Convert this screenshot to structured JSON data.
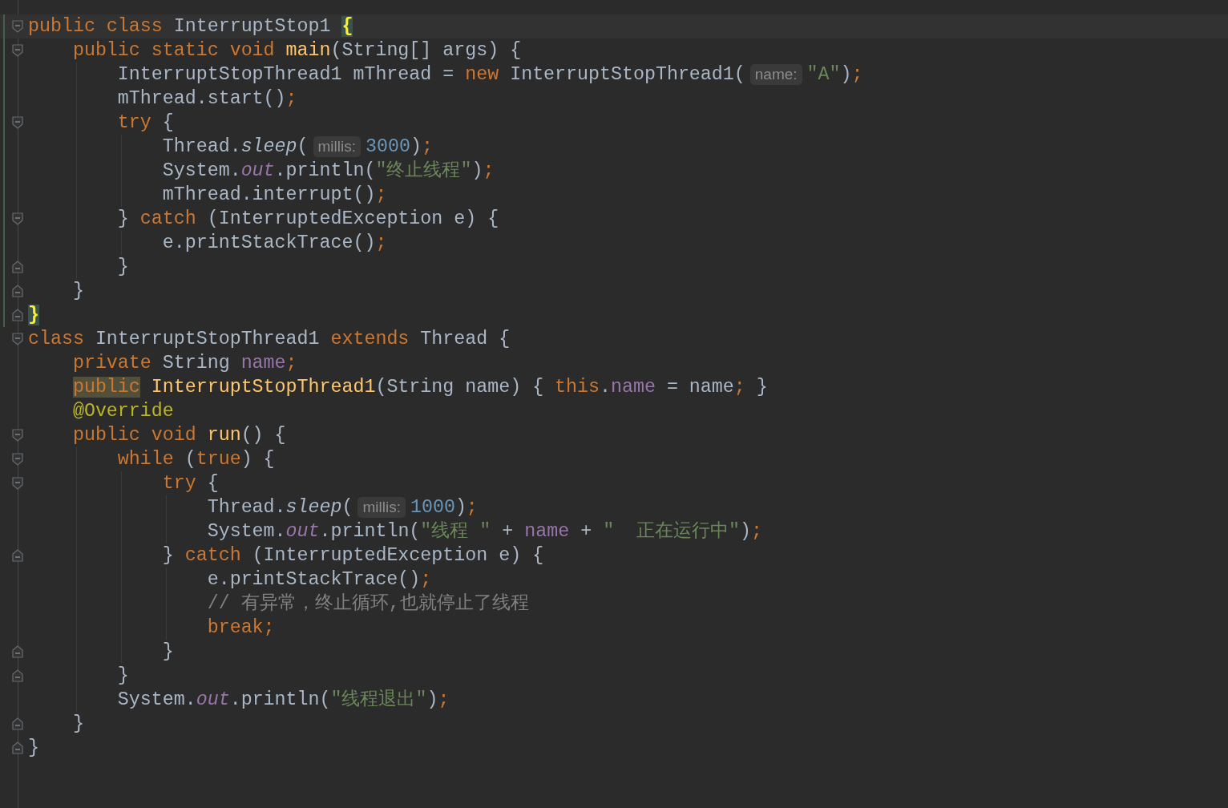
{
  "editor": {
    "lines": [
      {
        "kind": "fold-start",
        "current": true,
        "changed": true,
        "segments": [
          {
            "kind": "keyword",
            "text": "public class "
          },
          {
            "kind": "plain",
            "text": "InterruptStop1 "
          },
          {
            "kind": "brace-match",
            "text": "{"
          }
        ]
      },
      {
        "kind": "fold-start",
        "current": false,
        "changed": true,
        "segments": [
          {
            "kind": "keyword",
            "text": "    public static void "
          },
          {
            "kind": "declaration",
            "text": "main"
          },
          {
            "kind": "plain",
            "text": "(String[] args) {"
          }
        ]
      },
      {
        "kind": "line",
        "current": false,
        "changed": true,
        "segments": [
          {
            "kind": "plain",
            "text": "        InterruptStopThread1 mThread = "
          },
          {
            "kind": "keyword",
            "text": "new "
          },
          {
            "kind": "plain",
            "text": "InterruptStopThread1("
          },
          {
            "kind": "hint",
            "text": "name:"
          },
          {
            "kind": "string",
            "text": "\"A\""
          },
          {
            "kind": "plain",
            "text": ")"
          },
          {
            "kind": "keyword",
            "text": ";"
          }
        ]
      },
      {
        "kind": "line",
        "current": false,
        "changed": true,
        "segments": [
          {
            "kind": "plain",
            "text": "        mThread.start()"
          },
          {
            "kind": "keyword",
            "text": ";"
          }
        ]
      },
      {
        "kind": "fold-start",
        "current": false,
        "changed": true,
        "segments": [
          {
            "kind": "keyword",
            "text": "        try "
          },
          {
            "kind": "plain",
            "text": "{"
          }
        ]
      },
      {
        "kind": "line",
        "current": false,
        "changed": true,
        "segments": [
          {
            "kind": "plain",
            "text": "            Thread."
          },
          {
            "kind": "italic",
            "text": "sleep"
          },
          {
            "kind": "plain",
            "text": "("
          },
          {
            "kind": "hint",
            "text": "millis:"
          },
          {
            "kind": "number",
            "text": "3000"
          },
          {
            "kind": "plain",
            "text": ")"
          },
          {
            "kind": "keyword",
            "text": ";"
          }
        ]
      },
      {
        "kind": "line",
        "current": false,
        "changed": true,
        "segments": [
          {
            "kind": "plain",
            "text": "            System."
          },
          {
            "kind": "static",
            "text": "out"
          },
          {
            "kind": "plain",
            "text": ".println("
          },
          {
            "kind": "string",
            "text": "\"终止线程\""
          },
          {
            "kind": "plain",
            "text": ")"
          },
          {
            "kind": "keyword",
            "text": ";"
          }
        ]
      },
      {
        "kind": "line",
        "current": false,
        "changed": true,
        "segments": [
          {
            "kind": "plain",
            "text": "            mThread.interrupt()"
          },
          {
            "kind": "keyword",
            "text": ";"
          }
        ]
      },
      {
        "kind": "fold-start",
        "current": false,
        "changed": true,
        "segments": [
          {
            "kind": "plain",
            "text": "        } "
          },
          {
            "kind": "keyword",
            "text": "catch "
          },
          {
            "kind": "plain",
            "text": "(InterruptedException e) {"
          }
        ]
      },
      {
        "kind": "line",
        "current": false,
        "changed": true,
        "segments": [
          {
            "kind": "plain",
            "text": "            e.printStackTrace()"
          },
          {
            "kind": "keyword",
            "text": ";"
          }
        ]
      },
      {
        "kind": "fold-end",
        "current": false,
        "changed": true,
        "segments": [
          {
            "kind": "plain",
            "text": "        }"
          }
        ]
      },
      {
        "kind": "fold-end",
        "current": false,
        "changed": true,
        "segments": [
          {
            "kind": "plain",
            "text": "    }"
          }
        ]
      },
      {
        "kind": "fold-end",
        "current": false,
        "changed": true,
        "segments": [
          {
            "kind": "brace-match",
            "text": "}"
          }
        ]
      },
      {
        "kind": "fold-start",
        "current": false,
        "changed": false,
        "segments": [
          {
            "kind": "keyword",
            "text": "class "
          },
          {
            "kind": "plain",
            "text": "InterruptStopThread1 "
          },
          {
            "kind": "keyword",
            "text": "extends "
          },
          {
            "kind": "plain",
            "text": "Thread {"
          }
        ]
      },
      {
        "kind": "line",
        "current": false,
        "changed": false,
        "segments": [
          {
            "kind": "keyword",
            "text": "    private "
          },
          {
            "kind": "plain",
            "text": "String "
          },
          {
            "kind": "field",
            "text": "name"
          },
          {
            "kind": "keyword",
            "text": ";"
          }
        ]
      },
      {
        "kind": "line",
        "current": false,
        "changed": false,
        "segments": [
          {
            "kind": "keyword-highlight",
            "text": "    public"
          },
          {
            "kind": "declaration",
            "text": " InterruptStopThread1"
          },
          {
            "kind": "plain",
            "text": "(String name) { "
          },
          {
            "kind": "keyword",
            "text": "this"
          },
          {
            "kind": "plain",
            "text": "."
          },
          {
            "kind": "field",
            "text": "name"
          },
          {
            "kind": "plain",
            "text": " = name"
          },
          {
            "kind": "keyword",
            "text": ";"
          },
          {
            "kind": "plain",
            "text": " }"
          }
        ]
      },
      {
        "kind": "line",
        "current": false,
        "changed": false,
        "segments": [
          {
            "kind": "annotation",
            "text": "    @Override"
          }
        ]
      },
      {
        "kind": "fold-start",
        "current": false,
        "changed": false,
        "segments": [
          {
            "kind": "keyword",
            "text": "    public void "
          },
          {
            "kind": "declaration",
            "text": "run"
          },
          {
            "kind": "plain",
            "text": "() {"
          }
        ]
      },
      {
        "kind": "fold-start",
        "current": false,
        "changed": false,
        "segments": [
          {
            "kind": "keyword",
            "text": "        while "
          },
          {
            "kind": "plain",
            "text": "("
          },
          {
            "kind": "keyword",
            "text": "true"
          },
          {
            "kind": "plain",
            "text": ") {"
          }
        ]
      },
      {
        "kind": "fold-start",
        "current": false,
        "changed": false,
        "segments": [
          {
            "kind": "keyword",
            "text": "            try "
          },
          {
            "kind": "plain",
            "text": "{"
          }
        ]
      },
      {
        "kind": "line",
        "current": false,
        "changed": false,
        "segments": [
          {
            "kind": "plain",
            "text": "                Thread."
          },
          {
            "kind": "italic",
            "text": "sleep"
          },
          {
            "kind": "plain",
            "text": "("
          },
          {
            "kind": "hint",
            "text": "millis:"
          },
          {
            "kind": "number",
            "text": "1000"
          },
          {
            "kind": "plain",
            "text": ")"
          },
          {
            "kind": "keyword",
            "text": ";"
          }
        ]
      },
      {
        "kind": "line",
        "current": false,
        "changed": false,
        "segments": [
          {
            "kind": "plain",
            "text": "                System."
          },
          {
            "kind": "static",
            "text": "out"
          },
          {
            "kind": "plain",
            "text": ".println("
          },
          {
            "kind": "string",
            "text": "\"线程 \""
          },
          {
            "kind": "plain",
            "text": " + "
          },
          {
            "kind": "field",
            "text": "name"
          },
          {
            "kind": "plain",
            "text": " + "
          },
          {
            "kind": "string",
            "text": "\"  正在运行中\""
          },
          {
            "kind": "plain",
            "text": ")"
          },
          {
            "kind": "keyword",
            "text": ";"
          }
        ]
      },
      {
        "kind": "fold-end",
        "current": false,
        "changed": false,
        "segments": [
          {
            "kind": "plain",
            "text": "            } "
          },
          {
            "kind": "keyword",
            "text": "catch "
          },
          {
            "kind": "plain",
            "text": "(InterruptedException e) {"
          }
        ]
      },
      {
        "kind": "line",
        "current": false,
        "changed": false,
        "segments": [
          {
            "kind": "plain",
            "text": "                e.printStackTrace()"
          },
          {
            "kind": "keyword",
            "text": ";"
          }
        ]
      },
      {
        "kind": "line",
        "current": false,
        "changed": false,
        "segments": [
          {
            "kind": "comment",
            "text": "                // 有异常，终止循环,也就停止了线程"
          }
        ]
      },
      {
        "kind": "line",
        "current": false,
        "changed": false,
        "segments": [
          {
            "kind": "keyword",
            "text": "                break;"
          }
        ]
      },
      {
        "kind": "fold-end",
        "current": false,
        "changed": false,
        "segments": [
          {
            "kind": "plain",
            "text": "            }"
          }
        ]
      },
      {
        "kind": "fold-end",
        "current": false,
        "changed": false,
        "segments": [
          {
            "kind": "plain",
            "text": "        }"
          }
        ]
      },
      {
        "kind": "line",
        "current": false,
        "changed": false,
        "segments": [
          {
            "kind": "plain",
            "text": "        System."
          },
          {
            "kind": "static",
            "text": "out"
          },
          {
            "kind": "plain",
            "text": ".println("
          },
          {
            "kind": "string",
            "text": "\"线程退出\""
          },
          {
            "kind": "plain",
            "text": ")"
          },
          {
            "kind": "keyword",
            "text": ";"
          }
        ]
      },
      {
        "kind": "fold-end",
        "current": false,
        "changed": false,
        "segments": [
          {
            "kind": "plain",
            "text": "    }"
          }
        ]
      },
      {
        "kind": "fold-end",
        "current": false,
        "changed": false,
        "segments": [
          {
            "kind": "plain",
            "text": "}"
          }
        ]
      }
    ]
  }
}
